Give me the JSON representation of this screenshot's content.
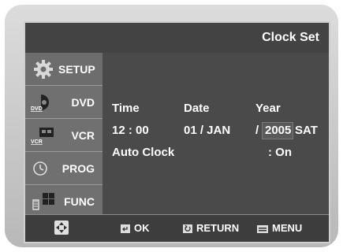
{
  "header": {
    "title": "Clock Set"
  },
  "sidebar": {
    "items": [
      {
        "label": "SETUP",
        "icon": "gear-icon"
      },
      {
        "label": "DVD",
        "icon": "dvd-icon",
        "sub": "DVD"
      },
      {
        "label": "VCR",
        "icon": "vcr-icon",
        "sub": "VCR"
      },
      {
        "label": "PROG",
        "icon": "clock-icon"
      },
      {
        "label": "FUNC",
        "icon": "remote-icon"
      }
    ]
  },
  "clock": {
    "time_label": "Time",
    "date_label": "Date",
    "year_label": "Year",
    "time_value": "12 : 00",
    "date_value": "01 / JAN",
    "year_sep": "/",
    "year_value": "2005",
    "weekday": "SAT",
    "auto_clock_label": "Auto Clock",
    "auto_clock_value": ": On"
  },
  "footer": {
    "nav_icon": "directional-pad-icon",
    "ok_label": "OK",
    "return_label": "RETURN",
    "menu_label": "MENU"
  },
  "colors": {
    "background": "#4a4a4a",
    "sidebar": "#707070",
    "text": "#ffffff"
  }
}
